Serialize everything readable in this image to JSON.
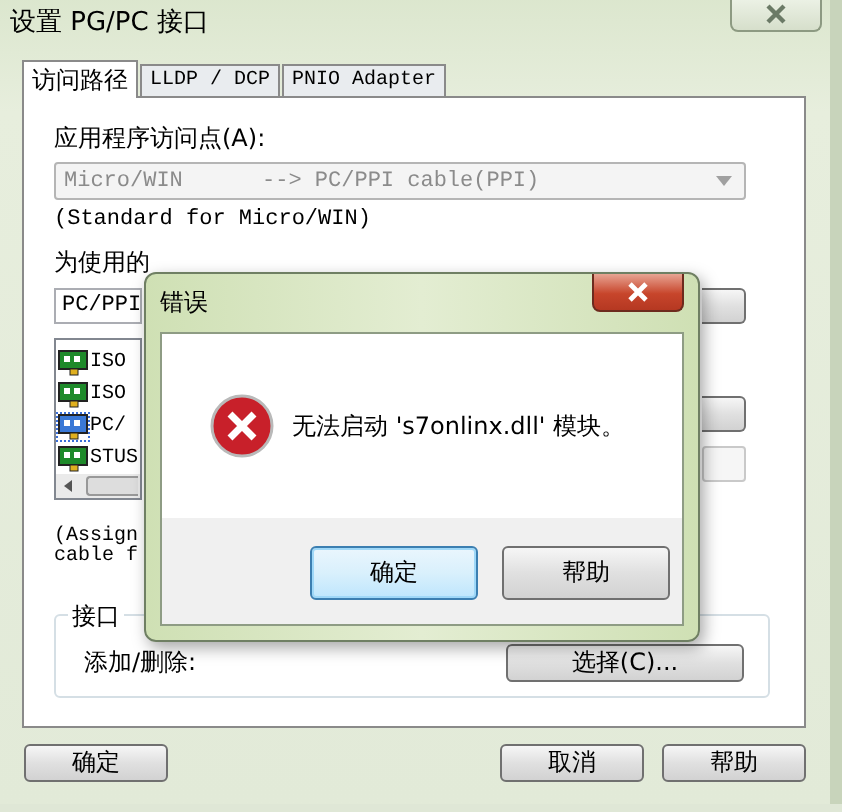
{
  "window": {
    "title": "设置 PG/PC 接口"
  },
  "tabs": [
    {
      "label": "访问路径",
      "selected": true
    },
    {
      "label": "LLDP / DCP",
      "selected": false
    },
    {
      "label": "PNIO Adapter",
      "selected": false
    }
  ],
  "access_point": {
    "label": "应用程序访问点(A):",
    "value": "Micro/WIN      --> PC/PPI cable(PPI)",
    "disabled": true,
    "note": "(Standard for Micro/WIN)"
  },
  "parameters": {
    "label": "为使用的",
    "value": "PC/PPI",
    "items": [
      {
        "label": "ISO",
        "selected": false
      },
      {
        "label": "ISO",
        "selected": false
      },
      {
        "label": "PC/",
        "selected": true
      },
      {
        "label": "STUS",
        "selected": false
      }
    ],
    "description": [
      "(Assign",
      "cable f"
    ]
  },
  "interface_group": {
    "title": "接口",
    "label": "添加/删除:",
    "button": "选择(C)..."
  },
  "buttons": [
    "确定",
    "取消",
    "帮助"
  ],
  "error_dialog": {
    "title": "错误",
    "message": "无法启动 's7onlinx.dll' 模块。",
    "buttons": [
      {
        "label": "确定",
        "selected": true
      },
      {
        "label": "帮助",
        "selected": false
      }
    ]
  }
}
